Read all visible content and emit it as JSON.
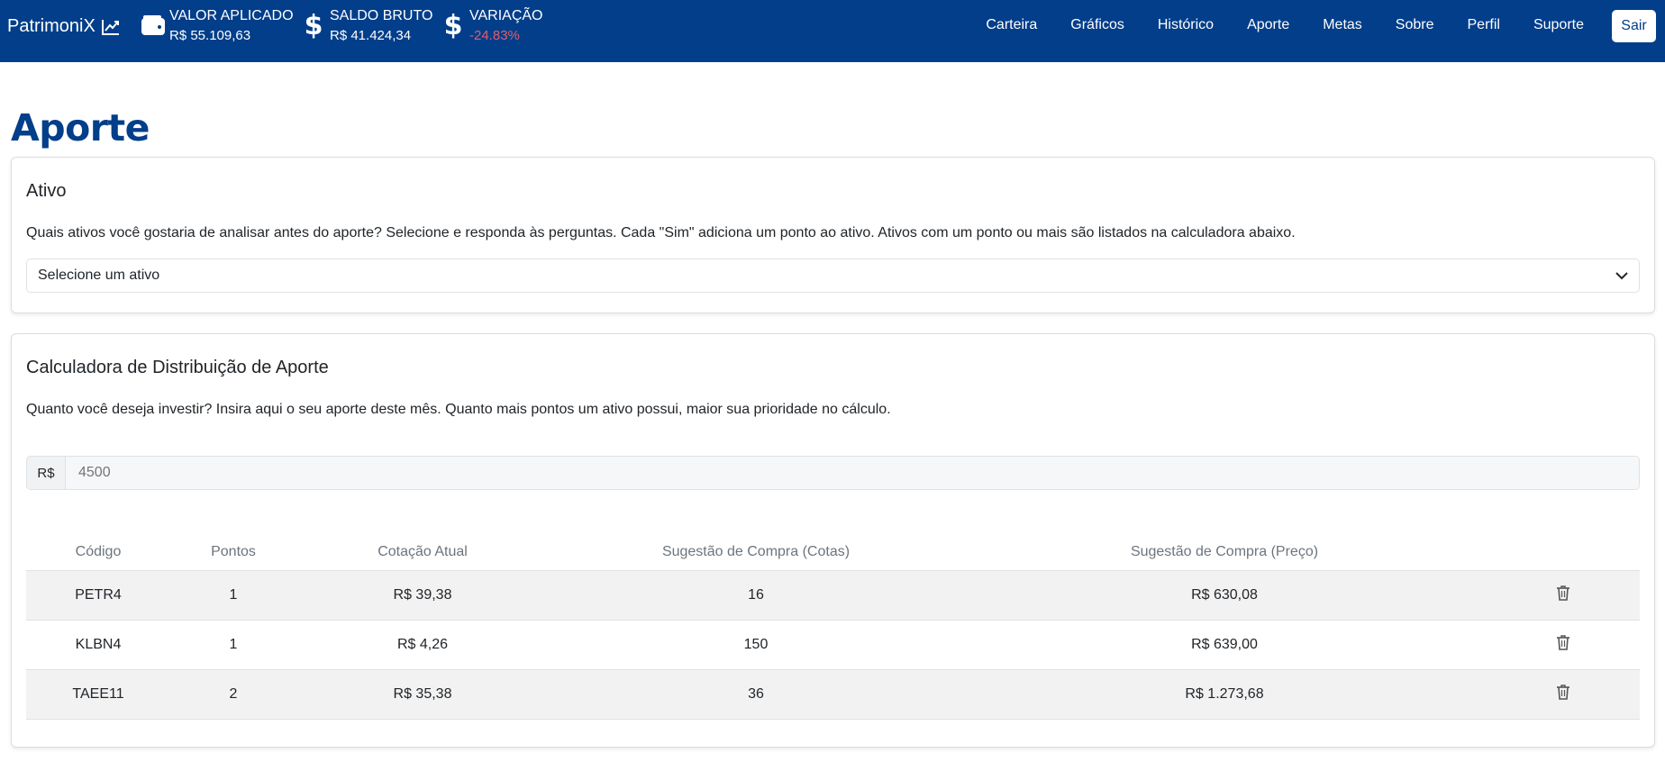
{
  "navbar": {
    "brand": "PatrimoniX",
    "stats": [
      {
        "label": "VALOR APLICADO",
        "value": "R$ 55.109,63",
        "icon": "wallet-icon"
      },
      {
        "label": "SALDO BRUTO",
        "value": "R$ 41.424,34",
        "icon": "dollar-icon"
      },
      {
        "label": "VARIAÇÃO",
        "value": "-24.83%",
        "icon": "dollar-icon"
      }
    ],
    "links": [
      "Carteira",
      "Gráficos",
      "Histórico",
      "Aporte",
      "Metas",
      "Sobre",
      "Perfil",
      "Suporte"
    ],
    "logout": "Sair"
  },
  "page": {
    "title": "Aporte"
  },
  "ativo_card": {
    "title": "Ativo",
    "description": "Quais ativos você gostaria de analisar antes do aporte? Selecione e responda às perguntas. Cada \"Sim\" adiciona um ponto ao ativo. Ativos com um ponto ou mais são listados na calculadora abaixo.",
    "select_value": "Selecione um ativo"
  },
  "calc_card": {
    "title": "Calculadora de Distribuição de Aporte",
    "description": "Quanto você deseja investir? Insira aqui o seu aporte deste mês. Quanto mais pontos um ativo possui, maior sua prioridade no cálculo.",
    "currency_prefix": "R$",
    "amount_placeholder": "4500",
    "table": {
      "headers": [
        "Código",
        "Pontos",
        "Cotação Atual",
        "Sugestão de Compra (Cotas)",
        "Sugestão de Compra (Preço)"
      ],
      "rows": [
        {
          "codigo": "PETR4",
          "pontos": "1",
          "cotacao": "R$ 39,38",
          "cotas": "16",
          "preco": "R$ 630,08"
        },
        {
          "codigo": "KLBN4",
          "pontos": "1",
          "cotacao": "R$ 4,26",
          "cotas": "150",
          "preco": "R$ 639,00"
        },
        {
          "codigo": "TAEE11",
          "pontos": "2",
          "cotacao": "R$ 35,38",
          "cotas": "36",
          "preco": "R$ 1.273,68"
        }
      ]
    }
  },
  "colors": {
    "navbar": "#023e8a",
    "negative": "#e35d6a",
    "title": "#023e8a"
  }
}
